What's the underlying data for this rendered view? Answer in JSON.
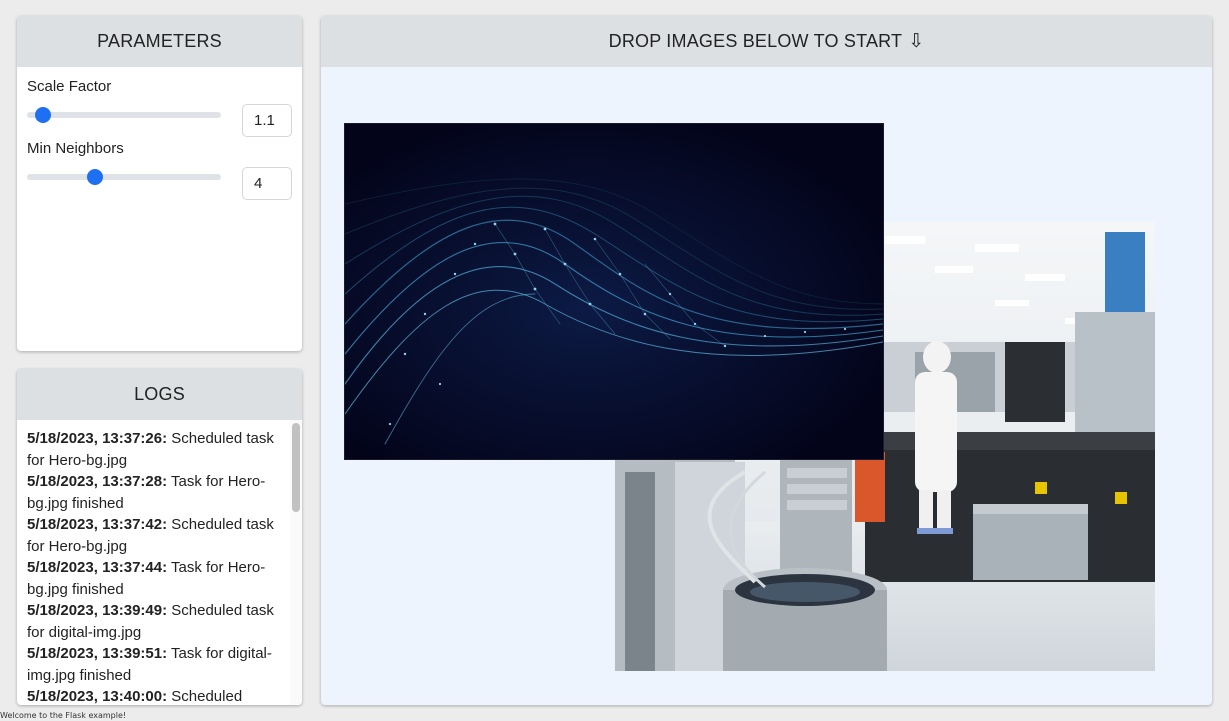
{
  "parameters": {
    "title": "PARAMETERS",
    "scale_factor": {
      "label": "Scale Factor",
      "value": "1.1",
      "slider_fraction": 0.08
    },
    "min_neighbors": {
      "label": "Min Neighbors",
      "value": "4",
      "slider_fraction": 0.35
    }
  },
  "logs": {
    "title": "LOGS",
    "entries": [
      {
        "time": "5/18/2023, 13:37:26:",
        "message": " Scheduled task for Hero-bg.jpg"
      },
      {
        "time": "5/18/2023, 13:37:28:",
        "message": " Task for Hero-bg.jpg finished"
      },
      {
        "time": "5/18/2023, 13:37:42:",
        "message": " Scheduled task for Hero-bg.jpg"
      },
      {
        "time": "5/18/2023, 13:37:44:",
        "message": " Task for Hero-bg.jpg finished"
      },
      {
        "time": "5/18/2023, 13:39:49:",
        "message": " Scheduled task for digital-img.jpg"
      },
      {
        "time": "5/18/2023, 13:39:51:",
        "message": " Task for digital-img.jpg finished"
      },
      {
        "time": "5/18/2023, 13:40:00:",
        "message": " Scheduled"
      }
    ]
  },
  "dropzone": {
    "title": "DROP IMAGES BELOW TO START",
    "arrow": "⇩"
  },
  "status_bar": {
    "text": "Welcome to the Flask example!"
  },
  "colors": {
    "accent": "#1f6ff2",
    "header_bg": "#dde0e3",
    "dropzone_bg": "#eef4fe",
    "page_bg": "#ececec"
  }
}
